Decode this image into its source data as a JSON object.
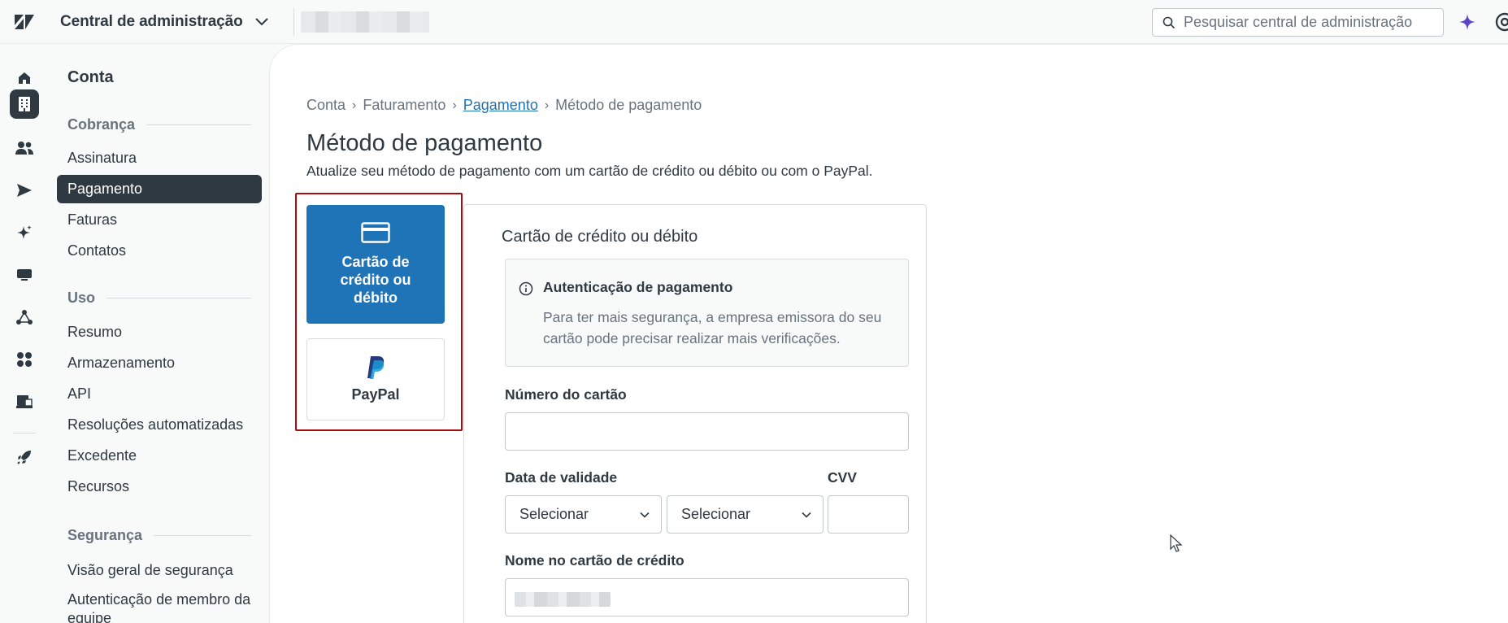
{
  "topbar": {
    "app_title": "Central de administração",
    "search_placeholder": "Pesquisar central de administração"
  },
  "subnav": {
    "title": "Conta",
    "sections": [
      {
        "heading": "Cobrança",
        "items": [
          "Assinatura",
          "Pagamento",
          "Faturas",
          "Contatos"
        ]
      },
      {
        "heading": "Uso",
        "items": [
          "Resumo",
          "Armazenamento",
          "API",
          "Resoluções automatizadas",
          "Excedente",
          "Recursos"
        ]
      },
      {
        "heading": "Segurança",
        "items": [
          "Visão geral de segurança",
          "Autenticação de membro da equipe"
        ]
      }
    ],
    "active_item": "Pagamento"
  },
  "breadcrumb": [
    "Conta",
    "Faturamento",
    "Pagamento",
    "Método de pagamento"
  ],
  "page": {
    "title": "Método de pagamento",
    "description": "Atualize seu método de pagamento com um cartão de crédito ou débito ou com o PayPal."
  },
  "methods": {
    "card_label": "Cartão de crédito ou débito",
    "paypal_label": "PayPal",
    "selected": "card"
  },
  "form": {
    "title": "Cartão de crédito ou débito",
    "notice_title": "Autenticação de pagamento",
    "notice_text": "Para ter mais segurança, a empresa emissora do seu cartão pode precisar realizar mais verificações.",
    "card_number_label": "Número do cartão",
    "card_number_value": "",
    "expiry_label": "Data de validade",
    "month_select": "Selecionar",
    "year_select": "Selecionar",
    "cvv_label": "CVV",
    "cvv_value": "",
    "name_label": "Nome no cartão de crédito"
  },
  "colors": {
    "accent": "#1f73b7",
    "dark": "#2f3941",
    "highlight_border": "#a50e0e",
    "ai": "#5e43c6"
  }
}
